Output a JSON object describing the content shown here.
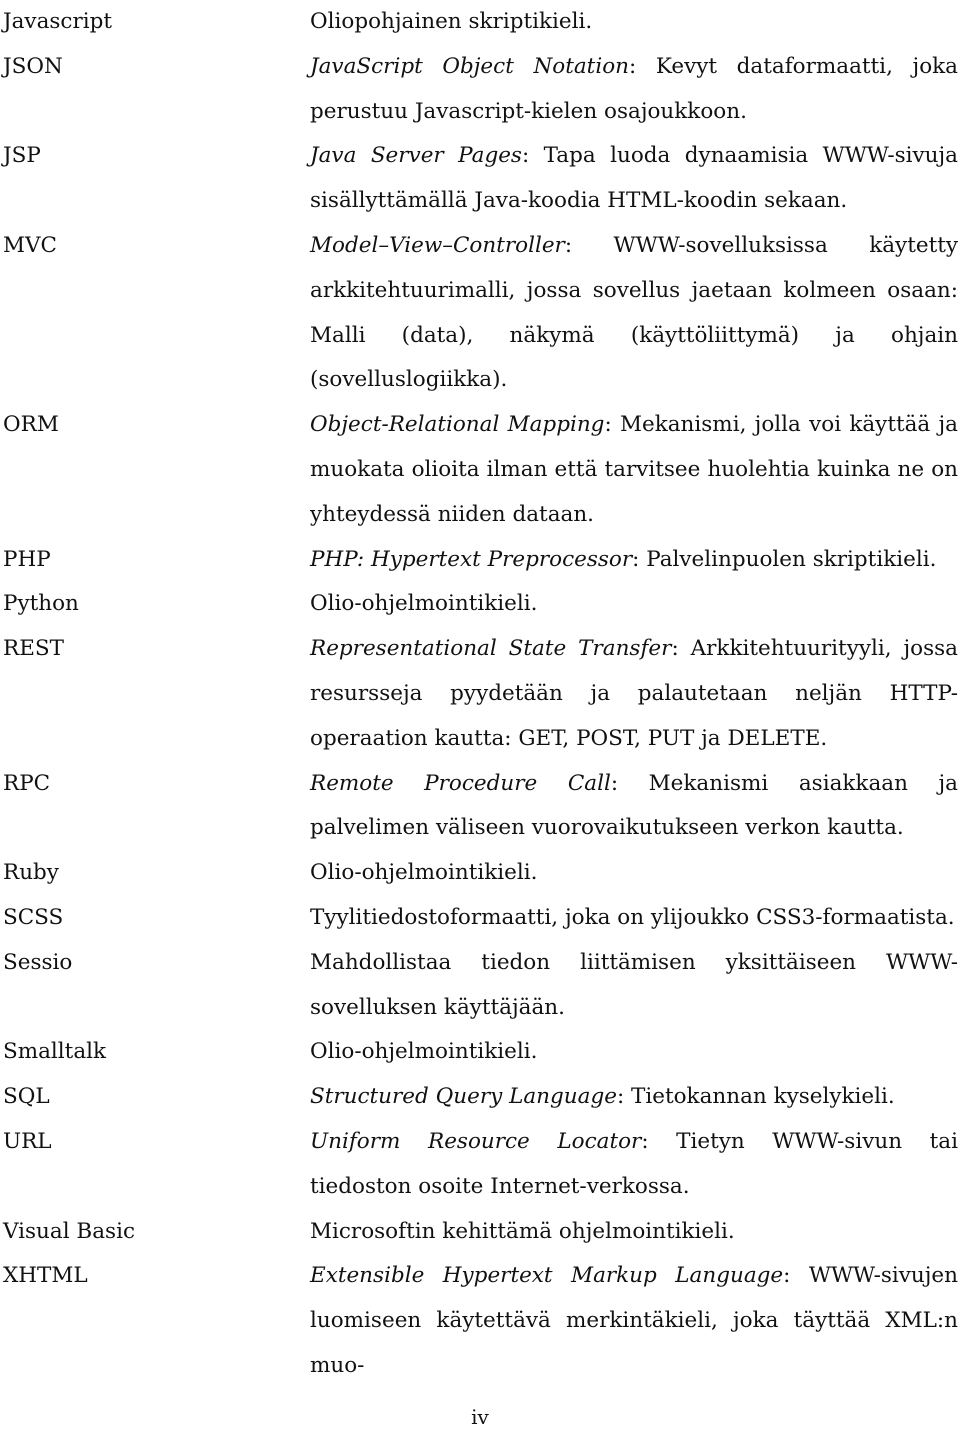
{
  "page": {
    "folio": "iv",
    "language": "fi"
  },
  "glossary": {
    "entries": [
      {
        "term": "Javascript",
        "expansion": "",
        "definition": "Oliopohjainen skriptikieli."
      },
      {
        "term": "JSON",
        "expansion": "JavaScript Object Notation",
        "definition": ": Kevyt dataformaatti, joka perustuu Javascript-kielen osajoukkoon."
      },
      {
        "term": "JSP",
        "expansion": "Java Server Pages",
        "definition": ": Tapa luoda dynaamisia WWW-sivuja sisällyttämällä Java-koodia HTML-koodin sekaan."
      },
      {
        "term": "MVC",
        "expansion": "Model–View–Controller",
        "definition": ": WWW-sovelluksissa käytetty arkkitehtuurimalli, jossa sovellus jaetaan kolmeen osaan: Malli (data), näkymä (käyttöliittymä) ja ohjain (sovelluslogiikka)."
      },
      {
        "term": "ORM",
        "expansion": "Object-Relational Mapping",
        "definition": ": Mekanismi, jolla voi käyttää ja muokata olioita ilman että tarvitsee huolehtia kuinka ne on yhteydessä niiden dataan."
      },
      {
        "term": "PHP",
        "expansion": "PHP: Hypertext Preprocessor",
        "definition": ": Palvelinpuolen skriptikieli."
      },
      {
        "term": "Python",
        "expansion": "",
        "definition": "Olio-ohjelmointikieli."
      },
      {
        "term": "REST",
        "expansion": "Representational State Transfer",
        "definition": ": Arkkitehtuurityyli, jossa resursseja pyydetään ja palautetaan neljän HTTP-operaation kautta: GET, POST, PUT ja DELETE."
      },
      {
        "term": "RPC",
        "expansion": "Remote Procedure Call",
        "definition": ": Mekanismi asiakkaan ja palvelimen väliseen vuorovaikutukseen verkon kautta."
      },
      {
        "term": "Ruby",
        "expansion": "",
        "definition": "Olio-ohjelmointikieli."
      },
      {
        "term": "SCSS",
        "expansion": "",
        "definition": "Tyylitiedostoformaatti, joka on ylijoukko CSS3-formaatista."
      },
      {
        "term": "Sessio",
        "expansion": "",
        "definition": "Mahdollistaa tiedon liittämisen yksittäiseen WWW-sovelluksen käyttäjään."
      },
      {
        "term": "Smalltalk",
        "expansion": "",
        "definition": "Olio-ohjelmointikieli."
      },
      {
        "term": "SQL",
        "expansion": "Structured Query Language",
        "definition": ": Tietokannan kyselykieli."
      },
      {
        "term": "URL",
        "expansion": "Uniform Resource Locator",
        "definition": ": Tietyn WWW-sivun tai tiedoston osoite Internet-verkossa."
      },
      {
        "term": "Visual Basic",
        "expansion": "",
        "definition": "Microsoftin kehittämä ohjelmointikieli."
      },
      {
        "term": "XHTML",
        "expansion": "Extensible Hypertext Markup Language",
        "definition": ": WWW-sivujen luomiseen käytettävä merkintäkieli, joka täyttää XML:n muo-"
      }
    ]
  }
}
